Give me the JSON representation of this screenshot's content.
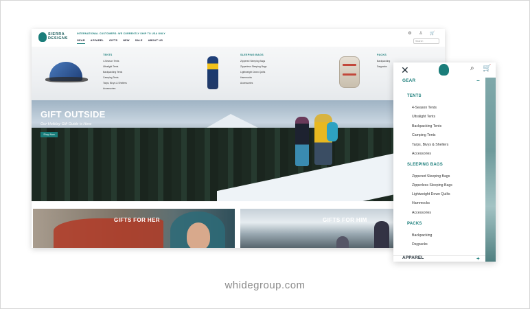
{
  "caption": "whidegroup.com",
  "desktop": {
    "logo_text": "SIERRA\nDESIGNS",
    "promo": "INTERNATIONAL CUSTOMERS: WE CURRENTLY SHIP TO USA ONLY",
    "icons": {
      "gear": "⚙",
      "account": "♙",
      "cart": "🛒"
    },
    "search_placeholder": "Search",
    "nav": [
      "GEAR",
      "APPAREL",
      "GIFTS",
      "NEW",
      "SALE",
      "ABOUT US"
    ],
    "mega": {
      "tents": {
        "title": "TENTS",
        "items": [
          "4-Season Tents",
          "Ultralight Tents",
          "Backpacking Tents",
          "Camping Tents",
          "Tarps, Bivys & Shelters",
          "Accessories"
        ]
      },
      "bags": {
        "title": "SLEEPING BAGS",
        "items": [
          "Zippered Sleeping Bags",
          "Zipperless Sleeping Bags",
          "Lightweight Down Quilts",
          "Hammocks",
          "Accessories"
        ]
      },
      "packs": {
        "title": "PACKS",
        "items": [
          "Backpacking",
          "Daypacks"
        ]
      }
    },
    "hero": {
      "title": "GIFT OUTSIDE",
      "subtitle": "Our Holiday Gift Guide is Here",
      "button": "Shop Now"
    },
    "tiles": {
      "her": "GIFTS FOR HER",
      "him": "GIFTS FOR HIM"
    }
  },
  "mobile": {
    "close": "✕",
    "search_icon": "⌕",
    "cart_icon": "🛒",
    "gear": "GEAR",
    "gear_sign": "−",
    "tents": {
      "title": "TENTS",
      "items": [
        "4-Season Tents",
        "Ultralight Tents",
        "Backpacking Tents",
        "Camping Tents",
        "Tarps, Bivys & Shelters",
        "Accessories"
      ]
    },
    "bags": {
      "title": "SLEEPING BAGS",
      "items": [
        "Zippered Sleeping Bags",
        "Zipperless Sleeping Bags",
        "Lightweight Down Quilts",
        "Hammocks",
        "Accessories"
      ]
    },
    "packs": {
      "title": "PACKS",
      "items": [
        "Backpacking",
        "Daypacks"
      ]
    },
    "apparel": "APPAREL",
    "apparel_sign": "+"
  },
  "colors": {
    "accent": "#1a7d7a",
    "dark": "#1d2a33"
  }
}
